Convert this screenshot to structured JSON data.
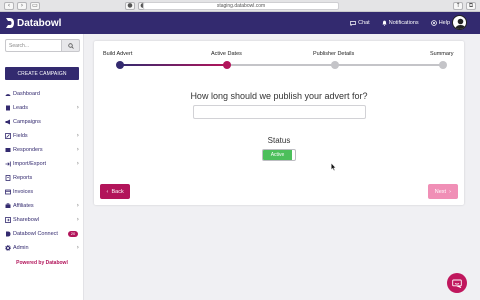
{
  "browser": {
    "url": "staging.databowl.com"
  },
  "topbar": {
    "brand": "Databowl",
    "chat_label": "Chat",
    "notifications_label": "Notifications",
    "help_label": "Help"
  },
  "sidebar": {
    "search_placeholder": "Search...",
    "create_label": "CREATE CAMPAIGN",
    "items": [
      {
        "label": "Dashboard",
        "icon": "dashboard-icon",
        "chevron": false
      },
      {
        "label": "Leads",
        "icon": "leads-icon",
        "chevron": true
      },
      {
        "label": "Campaigns",
        "icon": "campaigns-icon",
        "chevron": false
      },
      {
        "label": "Fields",
        "icon": "fields-icon",
        "chevron": true
      },
      {
        "label": "Responders",
        "icon": "responders-icon",
        "chevron": true
      },
      {
        "label": "Import/Export",
        "icon": "import-export-icon",
        "chevron": true
      },
      {
        "label": "Reports",
        "icon": "reports-icon",
        "chevron": false
      },
      {
        "label": "Invoices",
        "icon": "invoices-icon",
        "chevron": false
      },
      {
        "label": "Affiliates",
        "icon": "affiliates-icon",
        "chevron": true
      },
      {
        "label": "Sharebowl",
        "icon": "sharebowl-icon",
        "chevron": true
      },
      {
        "label": "Databowl Connect",
        "icon": "connect-icon",
        "badge": "20"
      },
      {
        "label": "Admin",
        "icon": "admin-icon",
        "chevron": true
      }
    ],
    "powered_by": "Powered by Databowl"
  },
  "wizard": {
    "steps": [
      {
        "label": "Build Advert",
        "state": "complete"
      },
      {
        "label": "Active Dates",
        "state": "current"
      },
      {
        "label": "Publisher Details",
        "state": "pending"
      },
      {
        "label": "Summary",
        "state": "pending"
      }
    ],
    "question": "How long should we publish your advert for?",
    "answer_value": "",
    "status_label": "Status",
    "status_toggle": "Active",
    "back_label": "Back",
    "next_label": "Next"
  },
  "colors": {
    "brand_navy": "#332a6f",
    "accent_pink": "#b2145a",
    "next_disabled": "#f08fb6",
    "toggle_green": "#4cbf5b",
    "step_pending": "#c4c4c8"
  }
}
